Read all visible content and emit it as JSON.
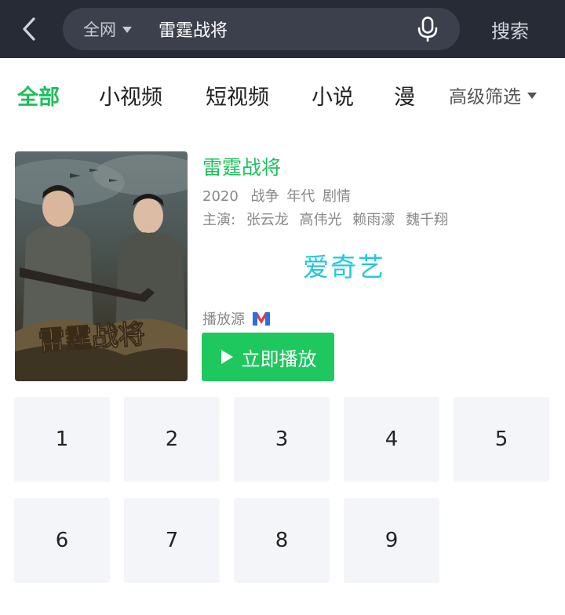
{
  "search": {
    "scope": "全网",
    "query": "雷霆战将",
    "submit_label": "搜索"
  },
  "tabs": [
    {
      "label": "全部"
    },
    {
      "label": "小视频"
    },
    {
      "label": "短视频"
    },
    {
      "label": "小说"
    },
    {
      "label": "漫"
    }
  ],
  "filter": {
    "label": "高级筛选"
  },
  "result": {
    "title": "雷霆战将",
    "year": "2020",
    "genres": [
      "战争",
      "年代",
      "剧情"
    ],
    "cast_label": "主演:",
    "cast": [
      "张云龙",
      "高伟光",
      "赖雨濛",
      "魏千翔"
    ],
    "platform": "爱奇艺",
    "source_label": "播放源",
    "play_label": "立即播放",
    "poster_title": "雷霆战将"
  },
  "episodes": [
    "1",
    "2",
    "3",
    "4",
    "5",
    "6",
    "7",
    "8",
    "9"
  ],
  "colors": {
    "accent": "#1fbf5c",
    "platform": "#22c8d8",
    "topbar": "#272b36"
  }
}
